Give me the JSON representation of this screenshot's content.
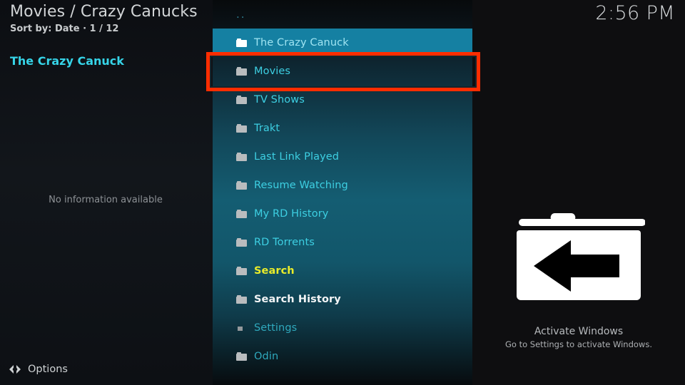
{
  "header": {
    "title": "Movies / Crazy Canucks",
    "subtitle": "Sort by: Date  ·  1 / 12"
  },
  "clock": {
    "time": "2:56 PM"
  },
  "info_panel": {
    "title": "The Crazy Canuck",
    "empty_text": "No information available"
  },
  "list": {
    "parent_label": "..",
    "items": [
      {
        "label": "The Crazy Canuck",
        "icon": "folder-icon",
        "selected": true,
        "color": "selected"
      },
      {
        "label": "Movies",
        "icon": "folder-icon",
        "selected": false,
        "color": "cyan"
      },
      {
        "label": "TV Shows",
        "icon": "folder-icon",
        "selected": false,
        "color": "cyan"
      },
      {
        "label": "Trakt",
        "icon": "folder-icon",
        "selected": false,
        "color": "cyan"
      },
      {
        "label": "Last Link Played",
        "icon": "folder-icon",
        "selected": false,
        "color": "cyan"
      },
      {
        "label": "Resume Watching",
        "icon": "folder-icon",
        "selected": false,
        "color": "cyan"
      },
      {
        "label": "My RD History",
        "icon": "folder-icon",
        "selected": false,
        "color": "cyan"
      },
      {
        "label": "RD Torrents",
        "icon": "folder-icon",
        "selected": false,
        "color": "cyan"
      },
      {
        "label": "Search",
        "icon": "folder-icon",
        "selected": false,
        "color": "yellow"
      },
      {
        "label": "Search History",
        "icon": "folder-icon",
        "selected": false,
        "color": "white"
      },
      {
        "label": "Settings",
        "icon": "square-icon",
        "selected": false,
        "color": "teal"
      },
      {
        "label": "Odin",
        "icon": "folder-icon",
        "selected": false,
        "color": "teal"
      }
    ]
  },
  "preview": {
    "icon": "folder-back-icon"
  },
  "watermark": {
    "line1": "Activate Windows",
    "line2": "Go to Settings to activate Windows."
  },
  "footer": {
    "options_label": "Options",
    "options_icon": "left-right-arrow-icon"
  },
  "colors": {
    "accent_cyan": "#3dcfe2",
    "selected_bg": "#1580a2",
    "annotation_red": "#ff2d00",
    "highlight_yellow": "#e9ec2a",
    "panel_teal": "#145d72"
  }
}
